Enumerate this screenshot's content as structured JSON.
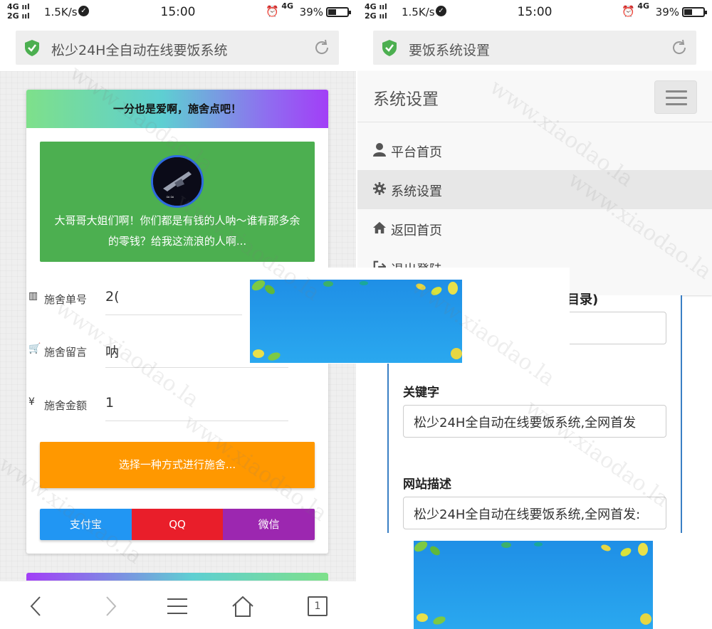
{
  "left": {
    "status": {
      "net_top": "4G ııl",
      "net_bottom": "2G ııl",
      "speed": "1.5K/s",
      "time": "15:00",
      "lte": "4G",
      "battery": "39%"
    },
    "url_title": "松少24H全自动在线要饭系统",
    "banner": "一分也是爱啊，施舍点吧！",
    "message": "大哥哥大姐们啊！你们都是有钱的人呐～谁有那多余的零钱？给我这流浪的人啊...",
    "fields": [
      {
        "label": "施舍单号",
        "value": "2("
      },
      {
        "label": "施舍留言",
        "value": "呐"
      },
      {
        "label": "施舍金额",
        "value": "1"
      }
    ],
    "choose_button": "选择一种方式进行施舍...",
    "pay": {
      "alipay": "支付宝",
      "qq": "QQ",
      "wechat": "微信"
    },
    "tab_count": "1",
    "colors": {
      "alipay": "#2196f3",
      "qq": "#e91e2a",
      "wechat": "#9c27b0",
      "green": "#4caf50",
      "orange": "#ff9800"
    }
  },
  "right": {
    "status": {
      "net_top": "4G ııl",
      "net_bottom": "2G ııl",
      "speed": "1.5K/s",
      "time": "15:00",
      "lte": "4G",
      "battery": "39%"
    },
    "url_title": "要饭系统设置",
    "header_title": "系统设置",
    "menu": [
      {
        "label": "平台首页",
        "icon": "user-icon"
      },
      {
        "label": "系统设置",
        "icon": "gear-icon"
      },
      {
        "label": "返回首页",
        "icon": "home-icon"
      },
      {
        "label": "退出登陆",
        "icon": "logout-icon"
      }
    ],
    "partial_label": "目录)",
    "keywords_label": "关键字",
    "keywords_value": "松少24H全自动在线要饭系统,全网首发",
    "description_label": "网站描述",
    "description_value": "松少24H全自动在线要饭系统,全网首发:"
  },
  "watermark": "www.xiaodao.la"
}
